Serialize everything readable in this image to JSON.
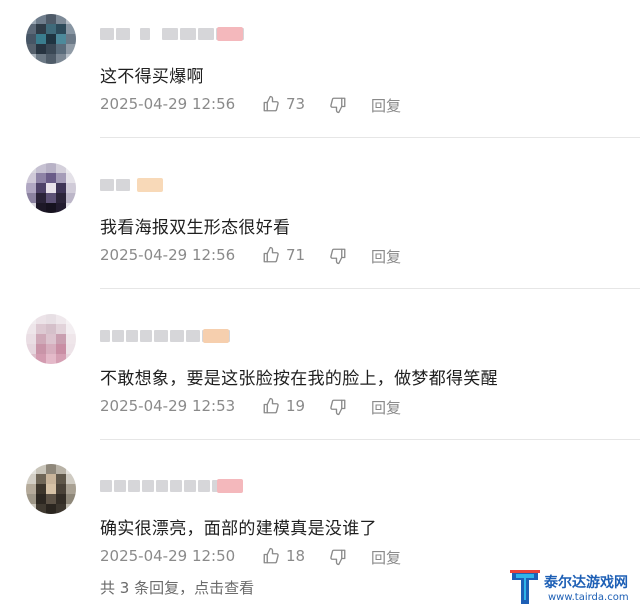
{
  "comments": [
    {
      "text": "这不得买爆啊",
      "time": "2025-04-29 12:56",
      "likes": "73",
      "reply": "回复"
    },
    {
      "text": "我看海报双生形态很好看",
      "time": "2025-04-29 12:56",
      "likes": "71",
      "reply": "回复"
    },
    {
      "text": "不敢想象，要是这张脸按在我的脸上，做梦都得笑醒",
      "time": "2025-04-29 12:53",
      "likes": "19",
      "reply": "回复"
    },
    {
      "text": "确实很漂亮，面部的建模真是没谁了",
      "time": "2025-04-29 12:50",
      "likes": "18",
      "reply": "回复"
    }
  ],
  "more_replies": "共 3 条回复，点击查看",
  "watermark": {
    "name": "泰尔达游戏网",
    "url": "www.tairda.com"
  },
  "colors": {
    "text": "#1f1f1f",
    "meta": "#8a8a8a",
    "divider": "#e6e6e6",
    "brand": "#1d5fb5"
  }
}
